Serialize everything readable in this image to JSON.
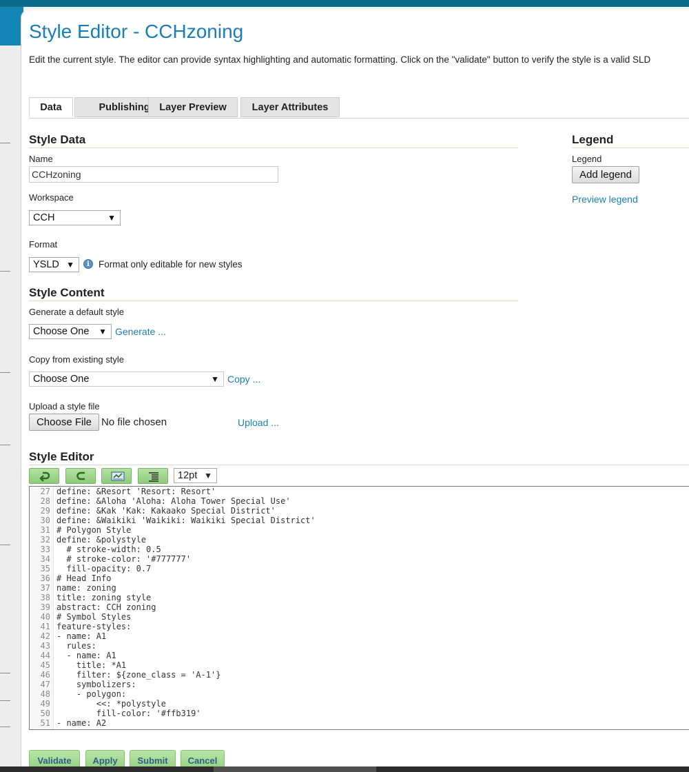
{
  "page": {
    "title": "Style Editor - CCHzoning",
    "description": "Edit the current style. The editor can provide syntax highlighting and automatic formatting. Click on the \"validate\" button to verify the style is a valid SLD"
  },
  "tabs": [
    {
      "label": "Data",
      "active": true
    },
    {
      "label": "Publishing",
      "active": false
    },
    {
      "label": "Layer Preview",
      "active": false
    },
    {
      "label": "Layer Attributes",
      "active": false
    }
  ],
  "style_data": {
    "heading": "Style Data",
    "name_label": "Name",
    "name_value": "CCHzoning",
    "workspace_label": "Workspace",
    "workspace_value": "CCH",
    "format_label": "Format",
    "format_value": "YSLD",
    "format_note": "Format only editable for new styles"
  },
  "legend": {
    "heading": "Legend",
    "label": "Legend",
    "add_button": "Add legend",
    "preview_link": "Preview legend"
  },
  "style_content": {
    "heading": "Style Content",
    "generate_label": "Generate a default style",
    "generate_select": "Choose One",
    "generate_link": "Generate ...",
    "copy_label": "Copy from existing style",
    "copy_select": "Choose One",
    "copy_link": "Copy ...",
    "upload_label": "Upload a style file",
    "choose_file_button": "Choose File",
    "no_file_text": "No file chosen",
    "upload_link": "Upload ..."
  },
  "style_editor": {
    "heading": "Style Editor",
    "tools": [
      {
        "icon": "undo-icon"
      },
      {
        "icon": "redo-icon"
      },
      {
        "icon": "go-to-line-icon"
      },
      {
        "icon": "reformat-icon"
      }
    ],
    "font_size": "12pt",
    "lines": [
      {
        "n": "27",
        "text": "define: &Resort 'Resort: Resort'"
      },
      {
        "n": "28",
        "text": "define: &Aloha 'Aloha: Aloha Tower Special Use'"
      },
      {
        "n": "29",
        "text": "define: &Kak 'Kak: Kakaako Special District'"
      },
      {
        "n": "30",
        "text": "define: &Waikiki 'Waikiki: Waikiki Special District'"
      },
      {
        "n": "31",
        "text": "# Polygon Style"
      },
      {
        "n": "32",
        "text": "define: &polystyle"
      },
      {
        "n": "33",
        "text": "  # stroke-width: 0.5"
      },
      {
        "n": "34",
        "text": "  # stroke-color: '#777777'"
      },
      {
        "n": "35",
        "text": "  fill-opacity: 0.7"
      },
      {
        "n": "36",
        "text": "# Head Info"
      },
      {
        "n": "37",
        "text": "name: zoning"
      },
      {
        "n": "38",
        "text": "title: zoning style"
      },
      {
        "n": "39",
        "text": "abstract: CCH zoning"
      },
      {
        "n": "40",
        "text": "# Symbol Styles"
      },
      {
        "n": "41",
        "text": "feature-styles:"
      },
      {
        "n": "42",
        "text": "- name: A1"
      },
      {
        "n": "43",
        "text": "  rules:"
      },
      {
        "n": "44",
        "text": "  - name: A1"
      },
      {
        "n": "45",
        "text": "    title: *A1"
      },
      {
        "n": "46",
        "text": "    filter: ${zone_class = 'A-1'}"
      },
      {
        "n": "47",
        "text": "    symbolizers:"
      },
      {
        "n": "48",
        "text": "    - polygon:"
      },
      {
        "n": "49",
        "text": "        <<: *polystyle"
      },
      {
        "n": "50",
        "text": "        fill-color: '#ffb319'"
      },
      {
        "n": "51",
        "text": "- name: A2"
      }
    ]
  },
  "actions": {
    "validate": "Validate",
    "apply": "Apply",
    "submit": "Submit",
    "cancel": "Cancel"
  }
}
